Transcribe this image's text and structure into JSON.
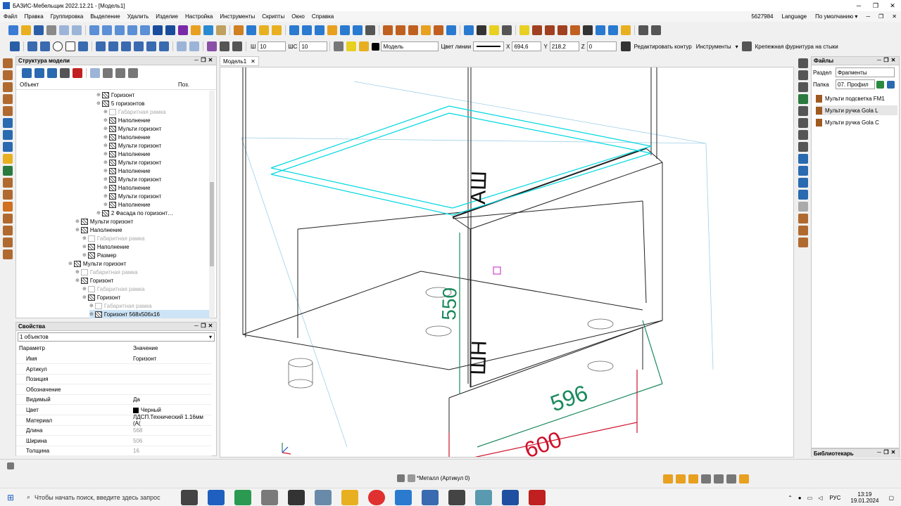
{
  "app": {
    "title": "БАЗИС-Мебельщик 2022.12.21 - [Модель1]"
  },
  "menu": {
    "items": [
      "Файл",
      "Правка",
      "Группировка",
      "Выделение",
      "Удалить",
      "Изделие",
      "Настройка",
      "Инструменты",
      "Скрипты",
      "Окно",
      "Справка"
    ],
    "right": [
      "5627984",
      "Language",
      "По умолчанию ▾"
    ]
  },
  "toolbar2": {
    "sh_label": "Ш",
    "sh_value": "10",
    "shs_label": "ШС",
    "shs_value": "10",
    "layer_value": "Модель",
    "line_color_label": "Цвет линии",
    "x_label": "X",
    "x_value": "694,6",
    "y_label": "Y",
    "y_value": "218,2",
    "z_label": "Z",
    "z_value": "0",
    "edit_contour": "Редактировать контур",
    "tools": "Инструменты",
    "fasteners": "Крепежная фурнитура на стыки"
  },
  "structure": {
    "title": "Структура модели",
    "col_object": "Объект",
    "col_pos": "Поз.",
    "rows": [
      {
        "text": "Горизонт",
        "indent": 11,
        "grey": false
      },
      {
        "text": "5 горизонтов",
        "indent": 11,
        "grey": false
      },
      {
        "text": "Габаритная рамка",
        "indent": 12,
        "grey": true
      },
      {
        "text": "Наполнение",
        "indent": 12,
        "grey": false
      },
      {
        "text": "Мульти горизонт",
        "indent": 12,
        "grey": false
      },
      {
        "text": "Наполнение",
        "indent": 12,
        "grey": false
      },
      {
        "text": "Мульти горизонт",
        "indent": 12,
        "grey": false
      },
      {
        "text": "Наполнение",
        "indent": 12,
        "grey": false
      },
      {
        "text": "Мульти горизонт",
        "indent": 12,
        "grey": false
      },
      {
        "text": "Наполнение",
        "indent": 12,
        "grey": false
      },
      {
        "text": "Мульти горизонт",
        "indent": 12,
        "grey": false
      },
      {
        "text": "Наполнение",
        "indent": 12,
        "grey": false
      },
      {
        "text": "Мульти горизонт",
        "indent": 12,
        "grey": false
      },
      {
        "text": "Наполнение",
        "indent": 12,
        "grey": false
      },
      {
        "text": "2 Фасада по горизонт…",
        "indent": 11,
        "grey": false
      },
      {
        "text": "Мульти горизонт",
        "indent": 8,
        "grey": false
      },
      {
        "text": "Наполнение",
        "indent": 8,
        "grey": false
      },
      {
        "text": "Габаритная рамка",
        "indent": 9,
        "grey": true
      },
      {
        "text": "Наполнение",
        "indent": 9,
        "grey": false
      },
      {
        "text": "Размер",
        "indent": 9,
        "grey": false
      },
      {
        "text": "Мульти горизонт",
        "indent": 7,
        "grey": false
      },
      {
        "text": "Габаритная рамка",
        "indent": 8,
        "grey": true
      },
      {
        "text": "Горизонт",
        "indent": 8,
        "grey": false
      },
      {
        "text": "Габаритная рамка",
        "indent": 9,
        "grey": true
      },
      {
        "text": "Горизонт",
        "indent": 9,
        "grey": false
      },
      {
        "text": "Габаритная рамка",
        "indent": 10,
        "grey": true
      },
      {
        "text": "Горизонт   568x506x16",
        "indent": 10,
        "grey": false,
        "selected": true
      }
    ]
  },
  "properties": {
    "title": "Свойства",
    "selector": "1 объектов",
    "col_param": "Параметр",
    "col_value": "Значение",
    "rows": [
      {
        "k": "Имя",
        "v": "Горизонт"
      },
      {
        "k": "Артикул",
        "v": ""
      },
      {
        "k": "Позиция",
        "v": ""
      },
      {
        "k": "Обозначение",
        "v": ""
      },
      {
        "k": "Видимый",
        "v": "Да"
      },
      {
        "k": "Цвет",
        "v": "Черный"
      },
      {
        "k": "Материал",
        "v": "ЛДСП.Технический 1.16мм (А("
      },
      {
        "k": "Длина",
        "v": "568"
      },
      {
        "k": "Ширина",
        "v": "506"
      },
      {
        "k": "Толщина",
        "v": "16"
      }
    ]
  },
  "document": {
    "tab": "Модель1"
  },
  "viewport": {
    "dim_height": "550",
    "dim_depth": "596",
    "dim_width": "600",
    "label_top": "АШ",
    "label_bottom": "ШН"
  },
  "files": {
    "title": "Файлы",
    "section_label": "Раздел",
    "section_value": "Фрагменты",
    "folder_label": "Папка",
    "folder_value": "07. Профил",
    "items": [
      "Мульти подсветка FM1",
      "Мульти ручка Gola L",
      "Мульти ручка Gola C"
    ]
  },
  "library": {
    "title": "Библиотекарь"
  },
  "status": {
    "material": "*Металл (Артикул 0)"
  },
  "taskbar": {
    "search_placeholder": "Чтобы начать поиск, введите здесь запрос",
    "lang": "РУС",
    "time": "13:19",
    "date": "19.01.2024"
  },
  "colors": {
    "accent": "#1f5fbf",
    "cyan_selection": "#00d8e0",
    "dim_green": "#1a8a5c",
    "dim_red": "#d0102a"
  }
}
